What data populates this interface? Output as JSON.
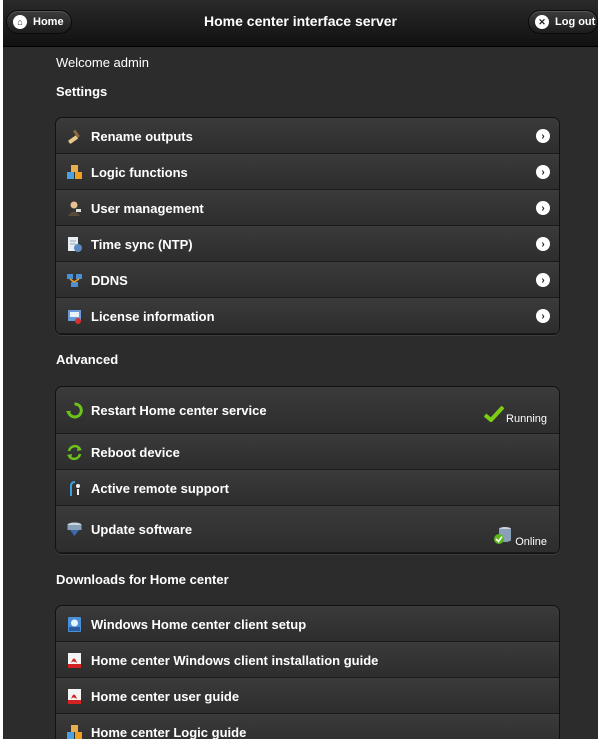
{
  "header": {
    "title": "Home center interface server",
    "home_label": "Home",
    "logout_label": "Log out"
  },
  "welcome": "Welcome admin",
  "settings": {
    "title": "Settings",
    "items": [
      {
        "label": "Rename outputs",
        "icon": "brush-icon"
      },
      {
        "label": "Logic functions",
        "icon": "cubes-icon"
      },
      {
        "label": "User management",
        "icon": "user-icon"
      },
      {
        "label": "Time sync (NTP)",
        "icon": "clock-document-icon"
      },
      {
        "label": "DDNS",
        "icon": "network-icon"
      },
      {
        "label": "License information",
        "icon": "certificate-icon"
      }
    ]
  },
  "advanced": {
    "title": "Advanced",
    "items": [
      {
        "label": "Restart Home center service",
        "icon": "restart-icon",
        "status": "Running",
        "status_icon": "check-icon"
      },
      {
        "label": "Reboot device",
        "icon": "reboot-icon"
      },
      {
        "label": "Active remote support",
        "icon": "remote-support-icon"
      },
      {
        "label": "Update software",
        "icon": "update-icon",
        "status": "Online",
        "status_icon": "online-icon"
      }
    ]
  },
  "downloads": {
    "title": "Downloads for Home center",
    "items": [
      {
        "label": "Windows Home center client setup",
        "icon": "msi-icon"
      },
      {
        "label": "Home center Windows client installation guide",
        "icon": "pdf-icon"
      },
      {
        "label": "Home center user guide",
        "icon": "pdf-icon"
      },
      {
        "label": "Home center Logic guide",
        "icon": "cubes-icon"
      }
    ]
  },
  "colors": {
    "background": "#2c2c2c",
    "header": "#111111",
    "status_ok": "#7ccd12",
    "restart_green": "#6cc21a",
    "pdf_red": "#d32222"
  }
}
